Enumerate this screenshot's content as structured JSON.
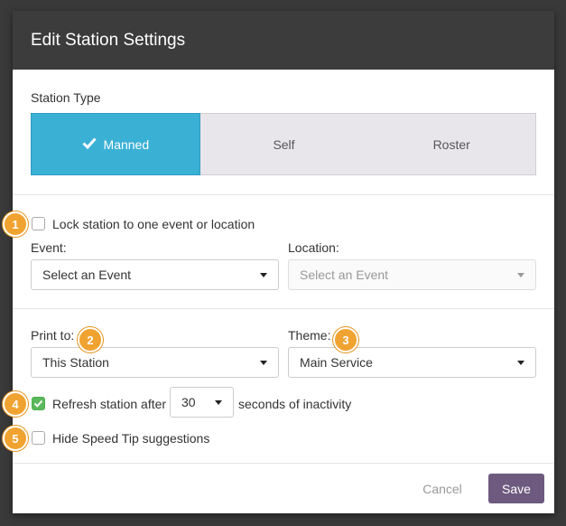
{
  "dialog": {
    "title": "Edit Station Settings"
  },
  "station_type": {
    "label": "Station Type",
    "options": [
      {
        "label": "Manned",
        "selected": true
      },
      {
        "label": "Self",
        "selected": false
      },
      {
        "label": "Roster",
        "selected": false
      }
    ]
  },
  "lock": {
    "checked": false,
    "label": "Lock station to one event or location",
    "badge": "1"
  },
  "event": {
    "label": "Event:",
    "value": "Select an Event"
  },
  "location": {
    "label": "Location:",
    "value": "Select an Event",
    "disabled": true
  },
  "print_to": {
    "label": "Print to:",
    "value": "This Station",
    "badge": "2"
  },
  "theme": {
    "label": "Theme:",
    "value": "Main Service",
    "badge": "3"
  },
  "refresh": {
    "checked": true,
    "label_before": "Refresh station after",
    "value": "30",
    "label_after": "seconds of inactivity",
    "badge": "4"
  },
  "speed_tip": {
    "checked": false,
    "label": "Hide Speed Tip suggestions",
    "badge": "5"
  },
  "footer": {
    "cancel_label": "Cancel",
    "save_label": "Save"
  },
  "colors": {
    "accent": "#3ab0d5",
    "save": "#6e5a7e",
    "badge": "#f0a330",
    "checked": "#5cb85c"
  }
}
